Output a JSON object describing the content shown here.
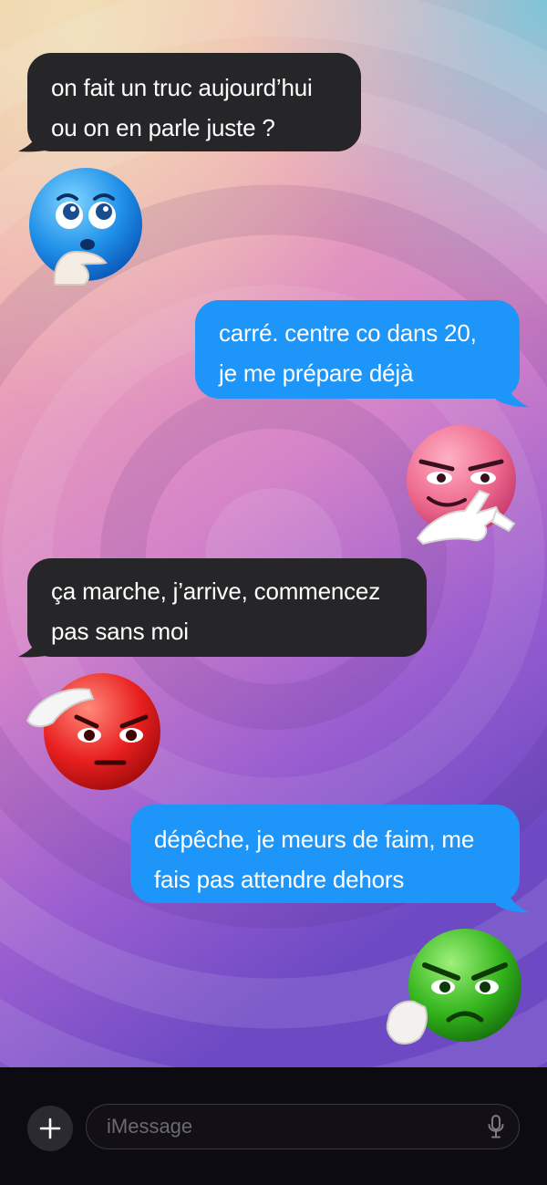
{
  "colors": {
    "incoming_bubble": "#262628",
    "outgoing_bubble": "#1e95f8",
    "bubble_text": "#ffffff",
    "composer_background": "#0d0b12",
    "placeholder_text": "#6b6970"
  },
  "messages": [
    {
      "direction": "incoming",
      "lines": [
        "on fait un truc aujourd’hui",
        "ou on en parle juste ?"
      ],
      "sticker": "thinking-blue-emoji"
    },
    {
      "direction": "outgoing",
      "lines": [
        "carré. centre co dans 20,",
        "je me prépare déjà"
      ],
      "sticker": "scheming-pink-emoji"
    },
    {
      "direction": "incoming",
      "lines": [
        "ça marche, j’arrive, commencez",
        "pas sans moi"
      ],
      "sticker": "saluting-red-emoji"
    },
    {
      "direction": "outgoing",
      "lines": [
        "dépêche, je meurs de faim, me",
        "fais pas attendre dehors"
      ],
      "sticker": "angry-green-emoji"
    }
  ],
  "composer": {
    "placeholder": "iMessage",
    "plus_icon": "plus-icon",
    "mic_icon": "microphone-icon"
  }
}
